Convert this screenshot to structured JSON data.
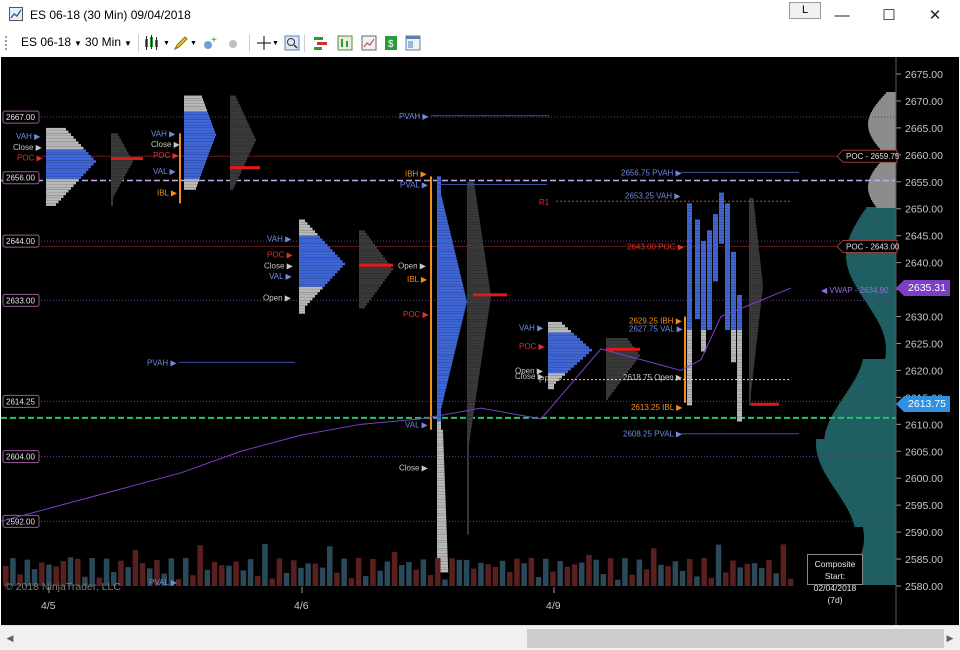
{
  "window": {
    "title": "ES 06-18 (30 Min)  09/04/2018",
    "link_button": "L",
    "minimize": "—",
    "maximize": "☐",
    "close": "✕"
  },
  "toolbar": {
    "instrument": "ES 06-18",
    "interval": "30 Min"
  },
  "chart": {
    "price_axis": [
      {
        "label": "2675.00",
        "price": 2675
      },
      {
        "label": "2670.00",
        "price": 2670
      },
      {
        "label": "2665.00",
        "price": 2665
      },
      {
        "label": "2660.00",
        "price": 2660
      },
      {
        "label": "2655.00",
        "price": 2655
      },
      {
        "label": "2650.00",
        "price": 2650
      },
      {
        "label": "2645.00",
        "price": 2645
      },
      {
        "label": "2640.00",
        "price": 2640
      },
      {
        "label": "2635.00",
        "price": 2635
      },
      {
        "label": "2630.00",
        "price": 2630
      },
      {
        "label": "2625.00",
        "price": 2625
      },
      {
        "label": "2620.00",
        "price": 2620
      },
      {
        "label": "2615.00",
        "price": 2615
      },
      {
        "label": "2610.00",
        "price": 2610
      },
      {
        "label": "2605.00",
        "price": 2605
      },
      {
        "label": "2600.00",
        "price": 2600
      },
      {
        "label": "2595.00",
        "price": 2595
      },
      {
        "label": "2590.00",
        "price": 2590
      },
      {
        "label": "2585.00",
        "price": 2585
      },
      {
        "label": "2580.00",
        "price": 2580
      }
    ],
    "time_axis": [
      "4/5",
      "4/6",
      "4/9"
    ],
    "left_levels": [
      "2667.00",
      "2656.00",
      "2644.00",
      "2633.00",
      "2614.25",
      "2604.00",
      "2592.00"
    ],
    "vwap_label": "VWAP - 2634.90",
    "vwap_tag": "2635.31",
    "last_tag": "2613.75",
    "poc_flags": [
      "POC - 2659.75",
      "POC - 2643.00"
    ],
    "r1": "R1",
    "pp": "PP",
    "labels_day1": [
      "VAH",
      "Close",
      "POC",
      "Open",
      "IBL",
      "IBL",
      "Open",
      "POC",
      "VAL",
      "IBL",
      "VAH",
      "PVAH"
    ],
    "labels_day2": [
      "VAH",
      "POC",
      "Close",
      "VAL",
      "Open",
      "IBH",
      "PVAL",
      "IBL",
      "POC",
      "Open",
      "VAL",
      "Close",
      "PVAH",
      "PVAL"
    ],
    "labels_day3": [
      "VAH",
      "POC",
      "Open",
      "Close",
      "VAL",
      "2656.75 PVAH",
      "2653.25 VAH",
      "2643.00 POC",
      "2629.25 IBH",
      "2627.75 VAL",
      "2618.75 Open",
      "2613.25 IBL",
      "2608.25 PVAL"
    ],
    "copyright": "© 2018 NinjaTrader, LLC",
    "composite_line1": "Composite Start:",
    "composite_line2": "02/04/2018 (7d)",
    "colors": {
      "background": "#000000",
      "profile_blue": "#3f66d6",
      "profile_gray": "#b8b8b8",
      "poc_red": "#e01818",
      "ib_orange": "#f28c1c",
      "vwap": "#7b3fc4",
      "last": "#2f8fe0",
      "teal_volume": "#1f5e61",
      "green_dash": "#26c26e",
      "lavender_dash": "#c8a8e8"
    }
  },
  "scrollbar": {
    "left_arrow": "◀",
    "right_arrow": "▶"
  }
}
